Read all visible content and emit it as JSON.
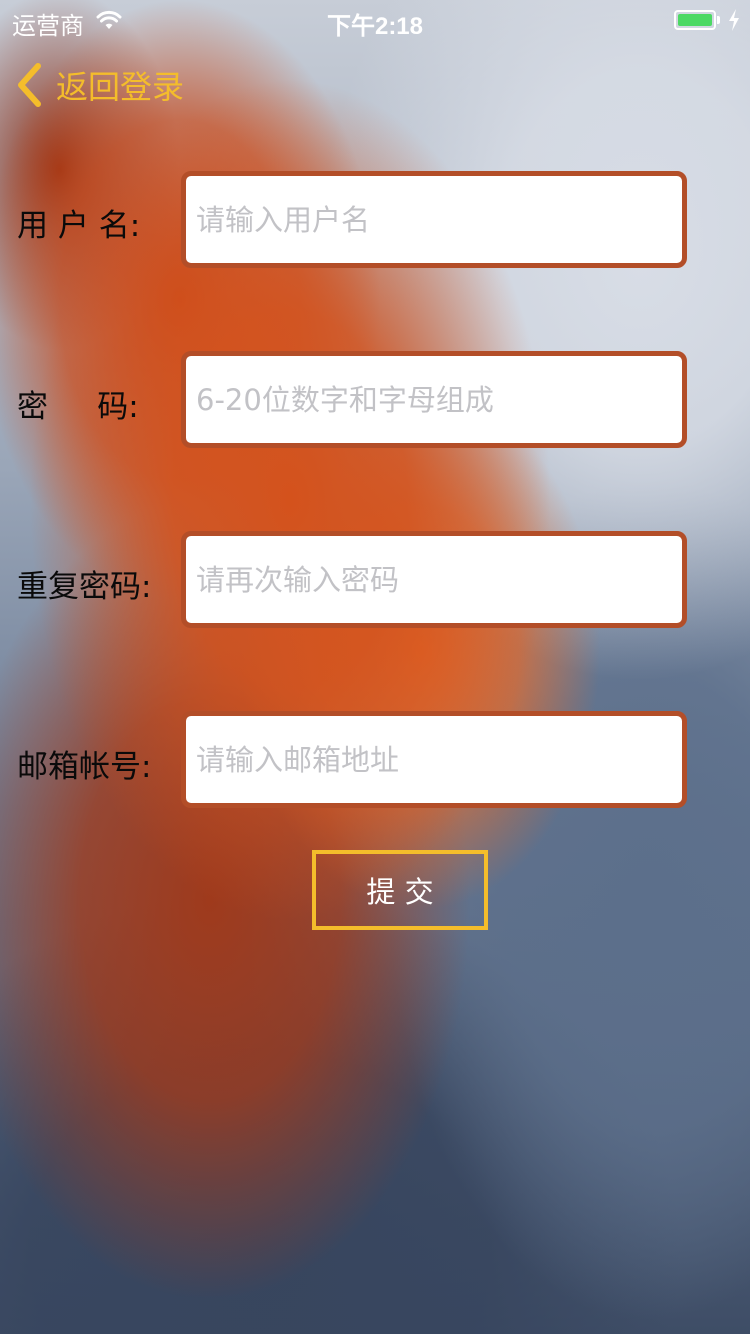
{
  "status_bar": {
    "carrier": "运营商",
    "time": "下午2:18"
  },
  "nav": {
    "back_label": "返回登录"
  },
  "form": {
    "username": {
      "label": "用 户 名:",
      "placeholder": "请输入用户名",
      "value": ""
    },
    "password": {
      "label": "密     码:",
      "placeholder": "6-20位数字和字母组成",
      "value": ""
    },
    "confirm_password": {
      "label": "重复密码:",
      "placeholder": "请再次输入密码",
      "value": ""
    },
    "email": {
      "label": "邮箱帐号:",
      "placeholder": "请输入邮箱地址",
      "value": ""
    },
    "submit_label": "提   交"
  },
  "colors": {
    "accent": "#f4bd2b",
    "field_border": "#b34e28",
    "battery": "#4cd964"
  }
}
